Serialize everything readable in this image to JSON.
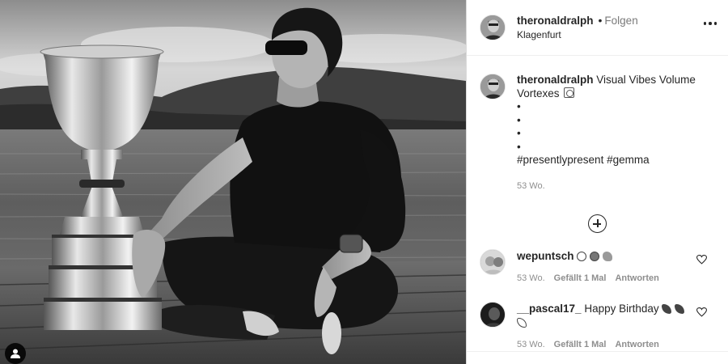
{
  "post": {
    "username": "theronaldralph",
    "separator": "•",
    "follow_label": "Folgen",
    "location": "Klagenfurt"
  },
  "caption": {
    "username": "theronaldralph",
    "text": "Visual Vibes Volume Vortexes",
    "bullets": [
      "•",
      "•",
      "•",
      "•"
    ],
    "hashtags": "#presentlypresent #gemma",
    "time": "53 Wo."
  },
  "comments": [
    {
      "username": "wepuntsch",
      "text": "",
      "emoji_icons": [
        "white-circle-icon",
        "gray-circle-icon",
        "flexed-biceps-icon"
      ],
      "time": "53 Wo.",
      "likes": "Gefällt 1 Mal",
      "reply_label": "Antworten"
    },
    {
      "username": "__pascal17_",
      "text": "Happy Birthday",
      "emoji_icons": [
        "party-popper-icon",
        "party-popper-icon",
        "party-popper-icon"
      ],
      "time": "53 Wo.",
      "likes": "Gefällt 1 Mal",
      "reply_label": "Antworten"
    }
  ],
  "colors": {
    "text": "#262626",
    "secondary": "#8e8e8e",
    "border": "#dbdbdb"
  }
}
